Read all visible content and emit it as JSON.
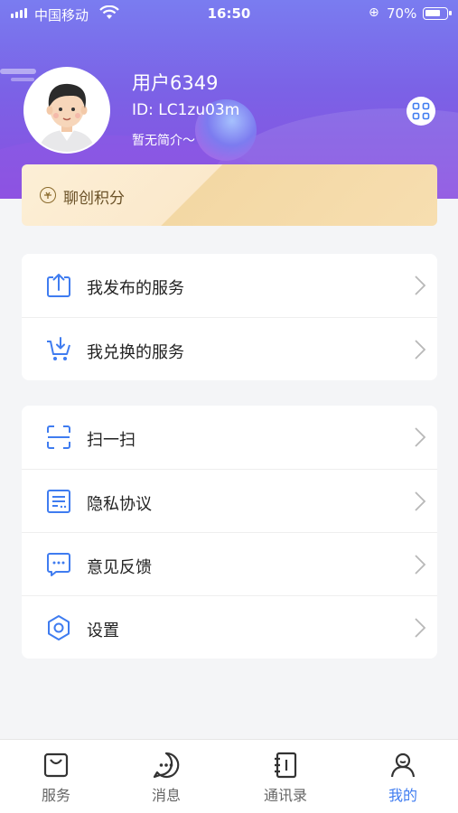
{
  "status_bar": {
    "carrier": "中国移动",
    "time": "16:50",
    "battery": "70%"
  },
  "profile": {
    "username": "用户6349",
    "user_id": "ID: LC1zu03m",
    "bio": "暂无简介～"
  },
  "points": {
    "label": "聊创积分"
  },
  "services": [
    {
      "label": "我发布的服务",
      "icon": "upload-icon"
    },
    {
      "label": "我兑换的服务",
      "icon": "cart-download-icon"
    }
  ],
  "settings_menu": [
    {
      "label": "扫一扫",
      "icon": "scan-icon"
    },
    {
      "label": "隐私协议",
      "icon": "document-icon"
    },
    {
      "label": "意见反馈",
      "icon": "feedback-icon"
    },
    {
      "label": "设置",
      "icon": "gear-icon"
    }
  ],
  "tabbar": [
    {
      "label": "服务",
      "icon": "bag-icon"
    },
    {
      "label": "消息",
      "icon": "chat-icon"
    },
    {
      "label": "通讯录",
      "icon": "contacts-icon"
    },
    {
      "label": "我的",
      "icon": "person-icon",
      "active": true
    }
  ],
  "colors": {
    "header_gradient_start": "#7a7cf0",
    "header_gradient_end": "#8a4fe0",
    "icon_blue": "#3f7cf0",
    "tab_active": "#3f7cf0",
    "points_text": "#6b5228"
  }
}
